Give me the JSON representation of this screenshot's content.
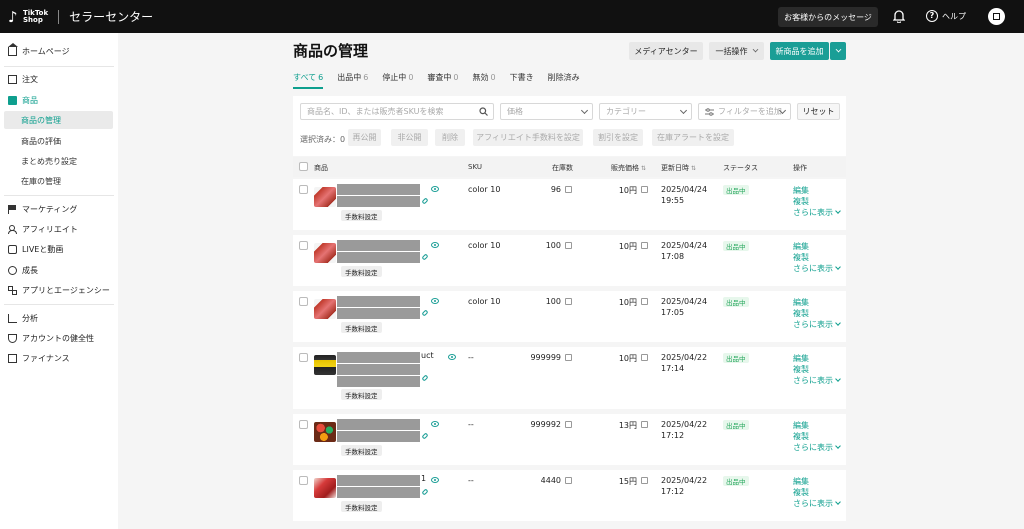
{
  "topbar": {
    "logo_line1": "TikTok",
    "logo_line2": "Shop",
    "title": "セラーセンター",
    "messages_label": "お客様からのメッセージ",
    "help_label": "ヘルプ"
  },
  "sidebar": {
    "home": "ホームページ",
    "orders": "注文",
    "products": "商品",
    "manage_products": "商品の管理",
    "reviews": "商品の評価",
    "bundles": "まとめ売り設定",
    "inventory": "在庫の管理",
    "marketing": "マーケティング",
    "affiliate": "アフィリエイト",
    "live": "LIVEと動画",
    "growth": "成長",
    "apps": "アプリとエージェンシー",
    "analytics": "分析",
    "account_health": "アカウントの健全性",
    "finance": "ファイナンス"
  },
  "header": {
    "title": "商品の管理",
    "media_center": "メディアセンター",
    "bulk_action": "一括操作",
    "add_product": "新商品を追加"
  },
  "tabs": [
    {
      "label": "すべて",
      "count": "6"
    },
    {
      "label": "出品中",
      "count": "6"
    },
    {
      "label": "停止中",
      "count": "0"
    },
    {
      "label": "審査中",
      "count": "0"
    },
    {
      "label": "無効",
      "count": "0"
    },
    {
      "label": "下書き",
      "count": ""
    },
    {
      "label": "削除済み",
      "count": ""
    }
  ],
  "filters": {
    "search_placeholder": "商品名、ID、または販売者SKUを検索",
    "price_placeholder": "価格",
    "category_placeholder": "カテゴリー",
    "add_filter": "フィルターを追加",
    "reset": "リセット",
    "selected_label": "選択済み：0",
    "bulk_republish": "再公開",
    "bulk_unpublish": "非公開",
    "bulk_delete": "削除",
    "bulk_affiliate": "アフィリエイト手数料を設定",
    "bulk_discount": "割引を設定",
    "bulk_stock_alert": "在庫アラートを設定"
  },
  "table": {
    "columns": {
      "product": "商品",
      "sku": "SKU",
      "stock": "在庫数",
      "price": "販売価格",
      "updated": "更新日時",
      "status": "ステータス",
      "actions": "操作"
    },
    "fee_tag": "手数料設定",
    "status_label": "出品中",
    "action_edit": "編集",
    "action_copy": "複製",
    "action_more": "さらに表示",
    "rows": [
      {
        "name_tail": "",
        "sku": "color 10",
        "stock": "96",
        "price": "10円",
        "date": "2025/04/24",
        "time": "19:55"
      },
      {
        "name_tail": "",
        "sku": "color 10",
        "stock": "100",
        "price": "10円",
        "date": "2025/04/24",
        "time": "17:08"
      },
      {
        "name_tail": "",
        "sku": "color 10",
        "stock": "100",
        "price": "10円",
        "date": "2025/04/24",
        "time": "17:05"
      },
      {
        "name_tail": "uct",
        "sku": "--",
        "stock": "999999",
        "price": "10円",
        "date": "2025/04/22",
        "time": "17:14"
      },
      {
        "name_tail": "",
        "sku": "--",
        "stock": "999992",
        "price": "13円",
        "date": "2025/04/22",
        "time": "17:12"
      },
      {
        "name_tail": "1",
        "sku": "--",
        "stock": "4440",
        "price": "15円",
        "date": "2025/04/22",
        "time": "17:12"
      }
    ]
  },
  "colors": {
    "accent": "#0e9f8e",
    "primary_button": "#1a9e96",
    "topbar": "#111111",
    "status_green": "#22a55a"
  }
}
